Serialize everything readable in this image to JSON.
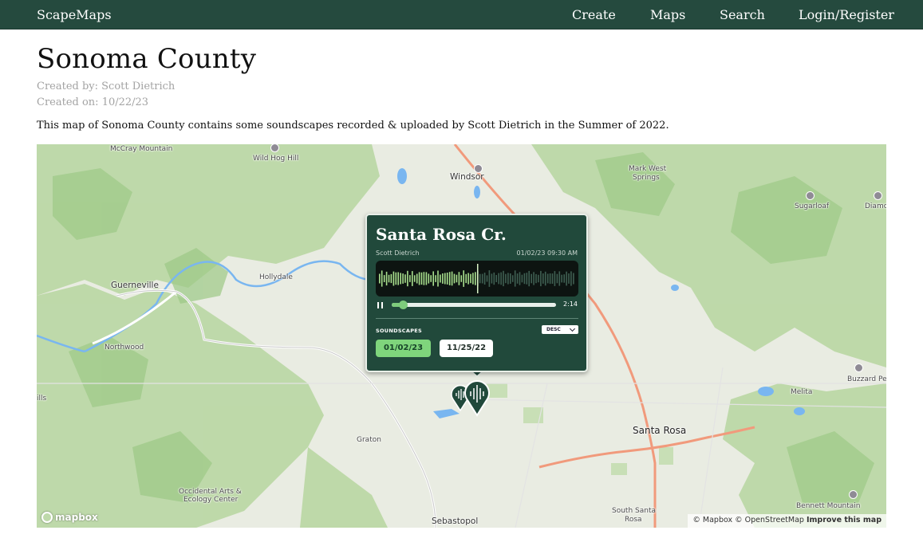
{
  "nav": {
    "brand": "ScapeMaps",
    "links": [
      "Create",
      "Maps",
      "Search",
      "Login/Register"
    ]
  },
  "header": {
    "title": "Sonoma County",
    "created_by": "Created by: Scott Dietrich",
    "created_on": "Created on: 10/22/23",
    "description": "This map of Sonoma County contains some soundscapes recorded & uploaded by Scott Dietrich in the Summer of 2022."
  },
  "map": {
    "places": {
      "mccray": "McCray Mountain",
      "wildhog": "Wild Hog Hill",
      "windsor": "Windsor",
      "markwest": "Mark West",
      "markwest2": "Springs",
      "sugarloaf": "Sugarloaf",
      "diamond": "Diamo",
      "guerneville": "Guerneville",
      "hollydale": "Hollydale",
      "northwood": "Northwood",
      "hills": "ills",
      "graton": "Graton",
      "occidental": "Occidental Arts &",
      "occidental2": "Ecology Center",
      "sebastopol": "Sebastopol",
      "santarosa": "Santa Rosa",
      "southsanta": "South Santa",
      "southsanta2": "Rosa",
      "melita": "Melita",
      "buzzard": "Buzzard Pea",
      "bennett": "Bennett Mountain"
    },
    "logo": "mapbox",
    "attribution": "© Mapbox © OpenStreetMap",
    "improve": "Improve this map",
    "colors": {
      "land": "#e9ece2",
      "forest": "#b9d7a2",
      "water": "#79b6f0",
      "road": "#f19a7c",
      "marker": "#21493b"
    }
  },
  "popup": {
    "title": "Santa Rosa Cr.",
    "author": "Scott Dietrich",
    "datetime": "01/02/23 09:30 AM",
    "duration": "2:14",
    "progress": 0.07,
    "playhead": 0.5,
    "section_label": "SOUNDSCAPES",
    "sort_label": "DESC",
    "chips": [
      "01/02/23",
      "11/25/22"
    ],
    "pause_icon": "pause-icon",
    "chevron_icon": "chevron-down-icon"
  }
}
